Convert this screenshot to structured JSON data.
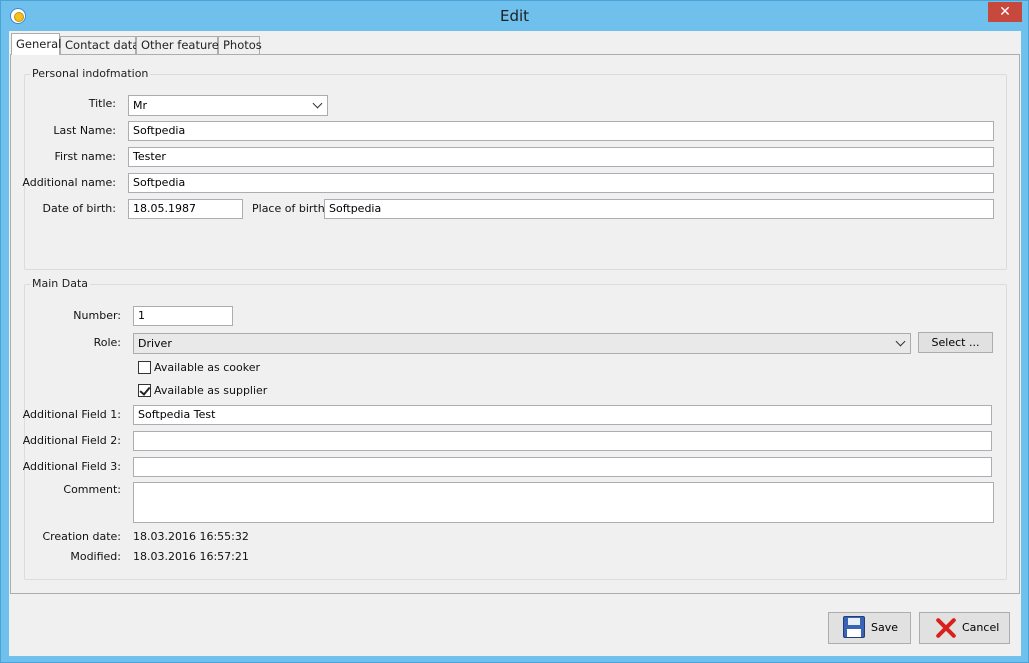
{
  "window": {
    "title": "Edit",
    "close_glyph": "✕"
  },
  "tabs": [
    {
      "label": "General",
      "active": true
    },
    {
      "label": "Contact data",
      "active": false
    },
    {
      "label": "Other features",
      "active": false
    },
    {
      "label": "Photos",
      "active": false
    }
  ],
  "personal": {
    "legend": "Personal indofmation",
    "title_label": "Title:",
    "title_value": "Mr",
    "last_name_label": "Last Name:",
    "last_name_value": "Softpedia",
    "first_name_label": "First name:",
    "first_name_value": "Tester",
    "additional_name_label": "Additional name:",
    "additional_name_value": "Softpedia",
    "dob_label": "Date of birth:",
    "dob_value": "18.05.1987",
    "pob_label": "Place of birth:",
    "pob_value": "Softpedia"
  },
  "main": {
    "legend": "Main Data",
    "number_label": "Number:",
    "number_value": "1",
    "role_label": "Role:",
    "role_value": "Driver",
    "select_label": "Select ...",
    "cooker_label": "Available as cooker",
    "cooker_checked": false,
    "supplier_label": "Available as supplier",
    "supplier_checked": true,
    "field1_label": "Additional Field 1:",
    "field1_value": "Softpedia Test",
    "field2_label": "Additional Field 2:",
    "field2_value": "",
    "field3_label": "Additional Field 3:",
    "field3_value": "",
    "comment_label": "Comment:",
    "comment_value": "",
    "creation_label": "Creation date:",
    "creation_value": "18.03.2016  16:55:32",
    "modified_label": "Modified:",
    "modified_value": "18.03.2016  16:57:21"
  },
  "footer": {
    "save_label": "Save",
    "cancel_label": "Cancel"
  },
  "icons": {
    "app": "app-icon",
    "save": "floppy-disk-icon",
    "cancel": "red-x-icon",
    "dropdown": "chevron-down-icon"
  }
}
